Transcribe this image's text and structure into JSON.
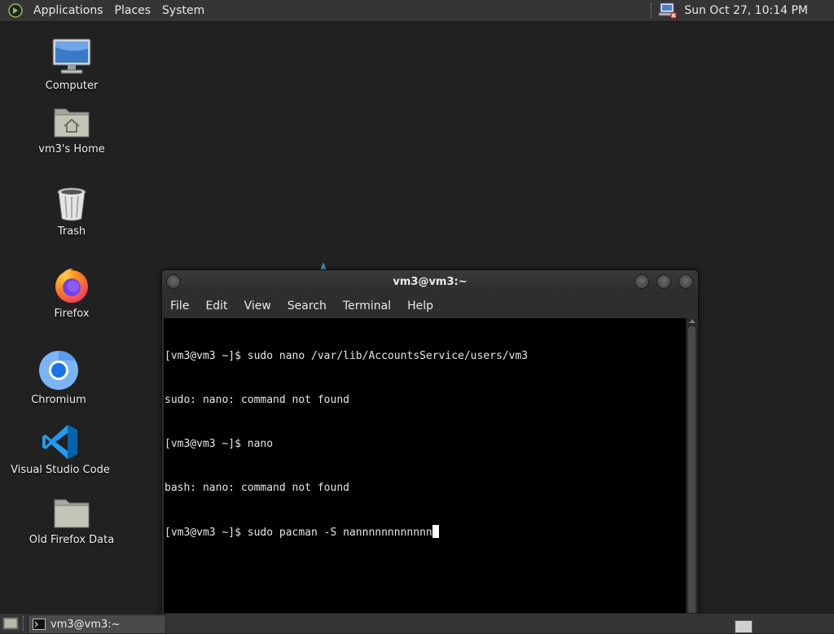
{
  "top_panel": {
    "menus": [
      "Applications",
      "Places",
      "System"
    ],
    "clock": "Sun Oct 27, 10:14 PM",
    "network_icon": "network-disconnected-icon"
  },
  "desktop_icons": [
    {
      "label": "Computer",
      "icon": "computer-icon"
    },
    {
      "label": "vm3's Home",
      "icon": "home-folder-icon"
    },
    {
      "label": "Trash",
      "icon": "trash-icon"
    },
    {
      "label": "Firefox",
      "icon": "firefox-icon"
    },
    {
      "label": "Chromium",
      "icon": "chromium-icon"
    },
    {
      "label": "Visual Studio Code",
      "icon": "vscode-icon"
    },
    {
      "label": "Old Firefox Data",
      "icon": "folder-icon"
    }
  ],
  "terminal": {
    "title": "vm3@vm3:~",
    "menu": [
      "File",
      "Edit",
      "View",
      "Search",
      "Terminal",
      "Help"
    ],
    "lines": [
      "[vm3@vm3 ~]$ sudo nano /var/lib/AccountsService/users/vm3",
      "sudo: nano: command not found",
      "[vm3@vm3 ~]$ nano",
      "bash: nano: command not found",
      "[vm3@vm3 ~]$ sudo pacman -S nannnnnnnnnnnn"
    ]
  },
  "bottom_panel": {
    "task_label": "vm3@vm3:~"
  }
}
